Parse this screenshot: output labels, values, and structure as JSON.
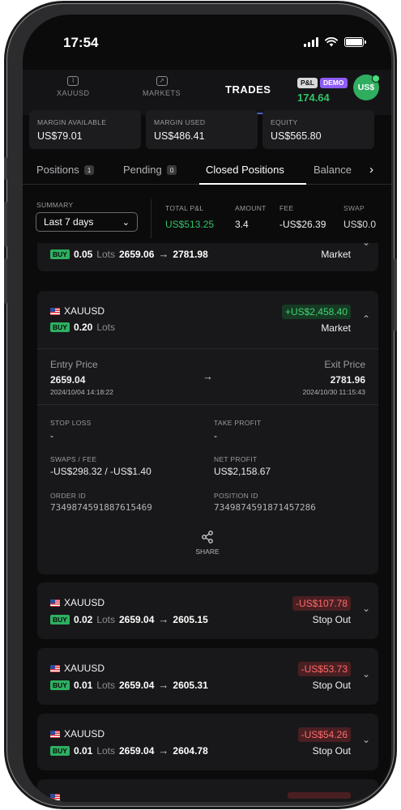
{
  "status": {
    "time": "17:54"
  },
  "nav": {
    "tabs": [
      {
        "label": "XAUUSD",
        "icon": "chart-icon"
      },
      {
        "label": "MARKETS",
        "icon": "markets-icon"
      }
    ],
    "active": "TRADES",
    "pl_badge": "P&L",
    "demo_badge": "DEMO",
    "pl_value": "174.64",
    "avatar": "US$"
  },
  "margins": [
    {
      "label": "MARGIN AVAILABLE",
      "value": "US$79.01"
    },
    {
      "label": "MARGIN USED",
      "value": "US$486.41"
    },
    {
      "label": "EQUITY",
      "value": "US$565.80"
    }
  ],
  "subtabs": {
    "positions": {
      "label": "Positions",
      "count": "1"
    },
    "pending": {
      "label": "Pending",
      "count": "0"
    },
    "closed": {
      "label": "Closed Positions"
    },
    "balance": {
      "label": "Balance"
    }
  },
  "summary": {
    "label": "SUMMARY",
    "period": "Last 7 days",
    "stats": {
      "total_pl": {
        "label": "TOTAL P&L",
        "value": "US$513.25"
      },
      "amount": {
        "label": "AMOUNT",
        "value": "3.4"
      },
      "fee": {
        "label": "FEE",
        "value": "-US$26.39"
      },
      "swap": {
        "label": "SWAP",
        "value": "US$0.0"
      }
    }
  },
  "positions": [
    {
      "lots": "0.05",
      "lots_label": "Lots",
      "entry": "2659.06",
      "exit": "2781.98",
      "type": "Market"
    },
    {
      "symbol": "XAUUSD",
      "side": "BUY",
      "lots": "0.20",
      "lots_label": "Lots",
      "pl": "+US$2,458.40",
      "type": "Market",
      "entry_label": "Entry Price",
      "entry": "2659.04",
      "entry_date": "2024/10/04 14:18:22",
      "exit_label": "Exit Price",
      "exit": "2781.96",
      "exit_date": "2024/10/30 11:15:43",
      "stop_loss_label": "STOP LOSS",
      "stop_loss": "-",
      "take_profit_label": "TAKE PROFIT",
      "take_profit": "-",
      "swaps_label": "SWAPS / FEE",
      "swaps": "-US$298.32 / -US$1.40",
      "net_label": "NET PROFIT",
      "net": "US$2,158.67",
      "order_label": "ORDER ID",
      "order_id": "7349874591887615469",
      "position_label": "POSITION ID",
      "position_id": "7349874591871457286",
      "share_label": "SHARE"
    },
    {
      "symbol": "XAUUSD",
      "side": "BUY",
      "lots": "0.02",
      "lots_label": "Lots",
      "entry": "2659.04",
      "exit": "2605.15",
      "pl": "-US$107.78",
      "type": "Stop Out"
    },
    {
      "symbol": "XAUUSD",
      "side": "BUY",
      "lots": "0.01",
      "lots_label": "Lots",
      "entry": "2659.04",
      "exit": "2605.31",
      "pl": "-US$53.73",
      "type": "Stop Out"
    },
    {
      "symbol": "XAUUSD",
      "side": "BUY",
      "lots": "0.01",
      "lots_label": "Lots",
      "entry": "2659.04",
      "exit": "2604.78",
      "pl": "-US$54.26",
      "type": "Stop Out"
    }
  ],
  "colors": {
    "profit": "#33c466",
    "loss": "#ff6b6b",
    "demo": "#8e5cf7",
    "accent": "#2fae60"
  }
}
